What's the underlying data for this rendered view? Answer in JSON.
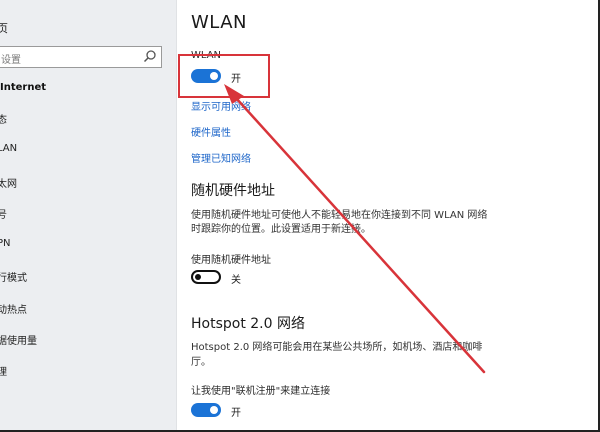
{
  "sidebar": {
    "home_label": "页",
    "search_placeholder": "设置",
    "section_label": "Internet",
    "items": [
      {
        "label": "态"
      },
      {
        "label": "LAN"
      },
      {
        "label": "太网"
      },
      {
        "label": "号"
      },
      {
        "label": "PN"
      },
      {
        "label": "行模式"
      },
      {
        "label": "动热点"
      },
      {
        "label": "据使用量"
      },
      {
        "label": "理"
      }
    ]
  },
  "main": {
    "title": "WLAN",
    "wlan_label": "WLAN",
    "wlan_toggle": {
      "state": "on",
      "state_label": "开"
    },
    "links": [
      "显示可用网络",
      "硬件属性",
      "管理已知网络"
    ],
    "random_hw": {
      "heading": "随机硬件地址",
      "description_line1": "使用随机硬件地址可使他人不能轻易地在你连接到不同 WLAN 网络",
      "description_line2": "时跟踪你的位置。此设置适用于新连接。",
      "toggle_label": "使用随机硬件地址",
      "toggle": {
        "state": "off",
        "state_label": "关"
      }
    },
    "hotspot": {
      "heading": "Hotspot 2.0 网络",
      "description_line1": "Hotspot 2.0 网络可能会用在某些公共场所，如机场、酒店和咖啡",
      "description_line2": "厅。",
      "toggle_label": "让我使用\"联机注册\"来建立连接",
      "toggle": {
        "state": "on",
        "state_label": "开"
      }
    }
  },
  "colors": {
    "accent": "#1b73d6",
    "link": "#1e66c9",
    "annotation": "#d8343a",
    "sidebar_bg": "#eceef1"
  },
  "icons": {
    "search": "search-icon"
  }
}
